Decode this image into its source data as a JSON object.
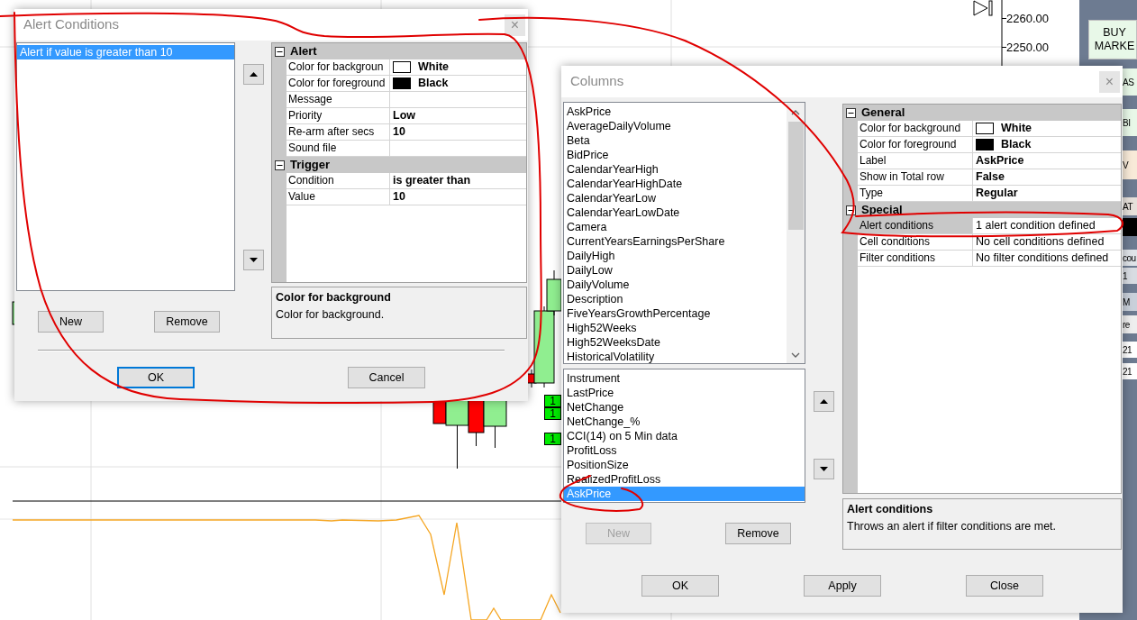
{
  "chart": {
    "price_labels": [
      "2260.00",
      "2250.00"
    ],
    "signal_badges": [
      "1",
      "1",
      "1"
    ]
  },
  "side_panel": {
    "items": [
      {
        "text": "BUY MARKE",
        "color": "#e8f8e8",
        "kind": "button"
      },
      {
        "text": "AS",
        "color": "#e8f8e8",
        "kind": "tab"
      },
      {
        "text": "BI",
        "color": "#e8f8e8",
        "kind": "tab"
      },
      {
        "text": "V",
        "color": "#f8ead8",
        "kind": "tab"
      },
      {
        "text": "AT",
        "color": "#e6e0da",
        "kind": "tab"
      },
      {
        "text": "cou",
        "color": "#dfe3e8",
        "kind": "tab"
      },
      {
        "text": "1",
        "color": "#d8dce2",
        "kind": "tab"
      },
      {
        "text": "M",
        "color": "#c9d0da",
        "kind": "tab"
      },
      {
        "text": "re",
        "color": "#eeeeee",
        "kind": "tab"
      },
      {
        "text": "21",
        "color": "#ffffff",
        "kind": "tab"
      },
      {
        "text": "21",
        "color": "#ffffff",
        "kind": "tab"
      }
    ]
  },
  "alert_dialog": {
    "title": "Alert Conditions",
    "close": "×",
    "list": [
      {
        "label": "Alert if value is greater than 10",
        "selected": true
      }
    ],
    "properties": [
      {
        "category": "Alert",
        "expanded": true,
        "rows": [
          {
            "name": "Color for backgroun",
            "value": "White",
            "color": "#ffffff",
            "modified": true,
            "selected": false
          },
          {
            "name": "Color for foreground",
            "value": "Black",
            "color": "#000000",
            "modified": true,
            "selected": false
          },
          {
            "name": "Message",
            "selected": false
          },
          {
            "name": "Priority",
            "value": "Low",
            "modified": true,
            "selected": false
          },
          {
            "name": "Re-arm after secs",
            "value": "10",
            "modified": true,
            "selected": false
          },
          {
            "name": "Sound file",
            "selected": false
          }
        ]
      },
      {
        "category": "Trigger",
        "expanded": true,
        "rows": [
          {
            "name": "Condition",
            "value": "is greater than",
            "modified": true,
            "selected": false
          },
          {
            "name": "Value",
            "value": "10",
            "modified": true,
            "selected": false
          }
        ]
      }
    ],
    "description": {
      "title": "Color for background",
      "text": "Color for background."
    },
    "list_buttons": [
      {
        "label": "New",
        "disabled": false
      },
      {
        "label": "Remove",
        "disabled": false
      }
    ],
    "buttons": [
      {
        "label": "OK",
        "default": true
      },
      {
        "label": "Cancel",
        "default": false
      }
    ]
  },
  "columns_dialog": {
    "title": "Columns",
    "close": "×",
    "available": [
      "AskPrice",
      "AverageDailyVolume",
      "Beta",
      "BidPrice",
      "CalendarYearHigh",
      "CalendarYearHighDate",
      "CalendarYearLow",
      "CalendarYearLowDate",
      "Camera",
      "CurrentYearsEarningsPerShare",
      "DailyHigh",
      "DailyLow",
      "DailyVolume",
      "Description",
      "FiveYearsGrowthPercentage",
      "High52Weeks",
      "High52WeeksDate",
      "HistoricalVolatility"
    ],
    "chosen": [
      {
        "label": "Instrument",
        "selected": false
      },
      {
        "label": "LastPrice",
        "selected": false
      },
      {
        "label": "NetChange",
        "selected": false
      },
      {
        "label": "NetChange_%",
        "selected": false
      },
      {
        "label": "CCI(14) on 5 Min data",
        "selected": false
      },
      {
        "label": "ProfitLoss",
        "selected": false
      },
      {
        "label": "PositionSize",
        "selected": false
      },
      {
        "label": "RealizedProfitLoss",
        "selected": false
      },
      {
        "label": "AskPrice",
        "selected": true
      }
    ],
    "properties": [
      {
        "category": "General",
        "expanded": true,
        "rows": [
          {
            "name": "Color for background",
            "value": "White",
            "color": "#ffffff",
            "modified": true,
            "selected": false
          },
          {
            "name": "Color for foreground",
            "value": "Black",
            "color": "#000000",
            "modified": true,
            "selected": false
          },
          {
            "name": "Label",
            "value": "AskPrice",
            "modified": true,
            "selected": false
          },
          {
            "name": "Show in Total row",
            "value": "False",
            "modified": true,
            "selected": false
          },
          {
            "name": "Type",
            "value": "Regular",
            "modified": true,
            "selected": false
          }
        ]
      },
      {
        "category": "Special",
        "expanded": true,
        "rows": [
          {
            "name": "Alert conditions",
            "value": "1 alert condition defined",
            "modified": false,
            "selected": true
          },
          {
            "name": "Cell conditions",
            "value": "No cell conditions defined",
            "modified": false,
            "selected": false
          },
          {
            "name": "Filter conditions",
            "value": "No filter conditions defined",
            "modified": false,
            "selected": false
          }
        ]
      }
    ],
    "description": {
      "title": "Alert conditions",
      "text": "Throws an alert if filter conditions are met."
    },
    "list_buttons": [
      {
        "label": "New",
        "disabled": true
      },
      {
        "label": "Remove",
        "disabled": false
      }
    ],
    "buttons": [
      {
        "label": "OK",
        "default": false
      },
      {
        "label": "Apply",
        "default": false
      },
      {
        "label": "Close",
        "default": false
      }
    ]
  }
}
